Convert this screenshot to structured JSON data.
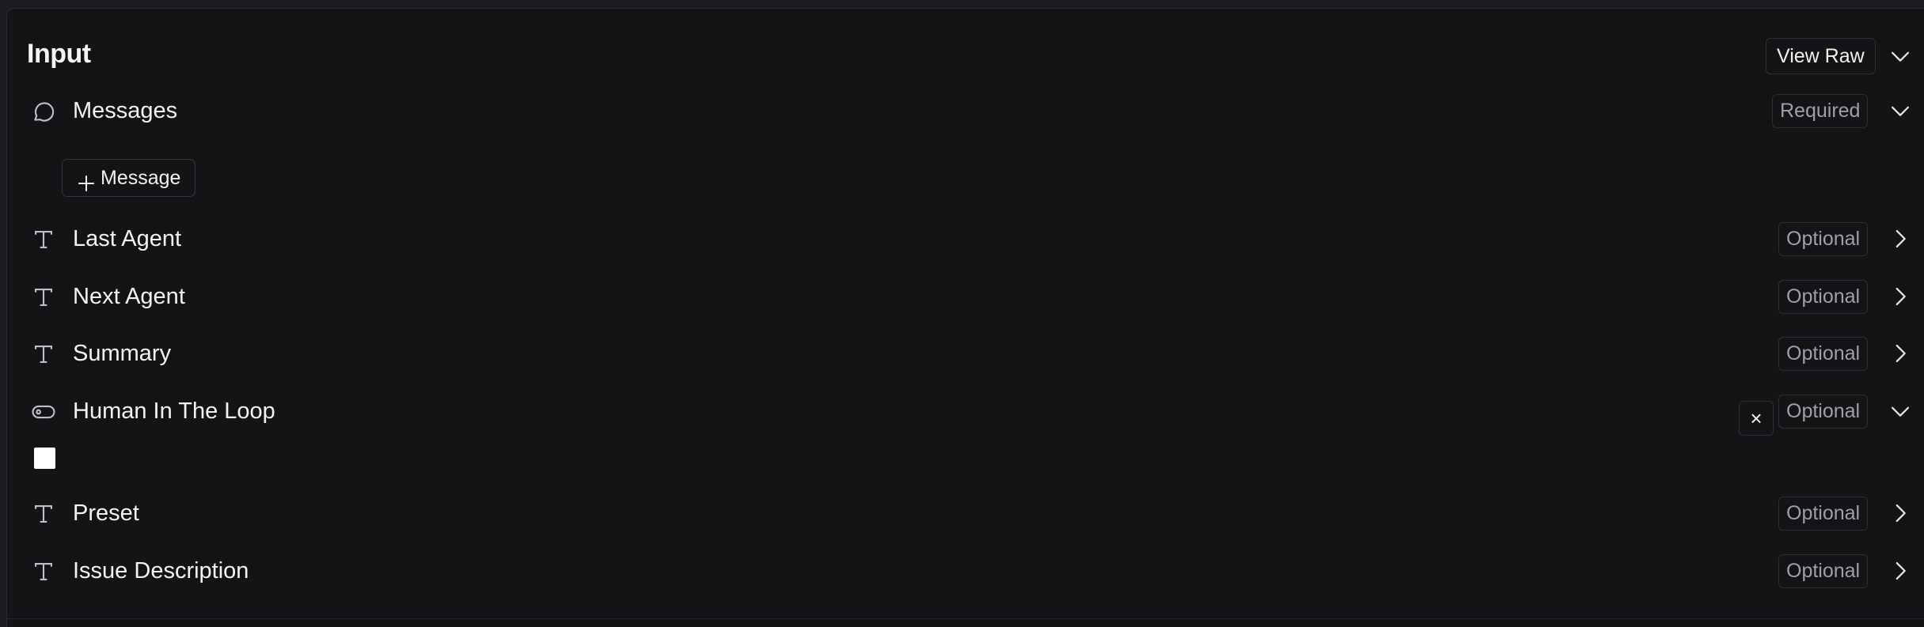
{
  "header": {
    "title": "Input",
    "view_raw_label": "View Raw"
  },
  "fields": [
    {
      "icon": "message-bubble-icon",
      "label": "Messages",
      "badge": "Required",
      "expanded": true
    },
    {
      "icon": "text-type-icon",
      "label": "Last Agent",
      "badge": "Optional",
      "expanded": false
    },
    {
      "icon": "text-type-icon",
      "label": "Next Agent",
      "badge": "Optional",
      "expanded": false
    },
    {
      "icon": "text-type-icon",
      "label": "Summary",
      "badge": "Optional",
      "expanded": false
    },
    {
      "icon": "toggle-icon",
      "label": "Human In The Loop",
      "badge": "Optional",
      "expanded": true
    },
    {
      "icon": "text-type-icon",
      "label": "Preset",
      "badge": "Optional",
      "expanded": false
    },
    {
      "icon": "text-type-icon",
      "label": "Issue Description",
      "badge": "Optional",
      "expanded": false
    }
  ],
  "messages": {
    "add_button_label": "Message"
  },
  "human_in_the_loop": {
    "clear_label": "×",
    "checked": false
  }
}
